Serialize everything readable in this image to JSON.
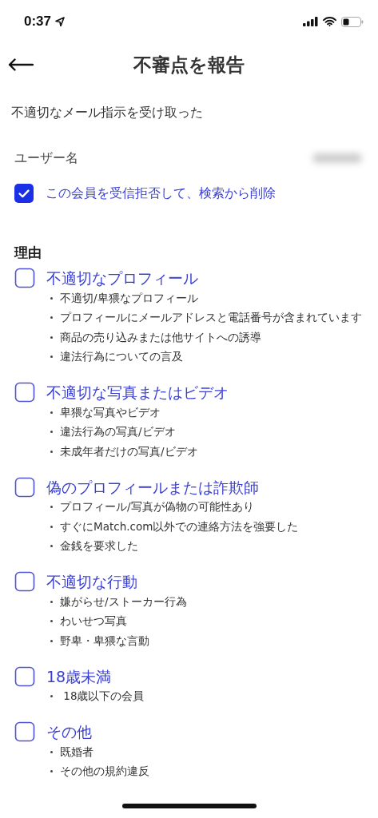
{
  "status_bar": {
    "time": "0:37"
  },
  "header": {
    "title": "不審点を報告"
  },
  "subtitle": "不適切なメール指示を受け取った",
  "username_label": "ユーザー名",
  "block_option": {
    "label": "この会員を受信拒否して、検索から削除",
    "checked": true
  },
  "reasons_heading": "理由",
  "reasons": [
    {
      "title": "不適切なプロフィール",
      "checked": false,
      "items": [
        "不適切/卑猥なプロフィール",
        "プロフィールにメールアドレスと電話番号が含まれています",
        "商品の売り込みまたは他サイトへの誘導",
        "違法行為についての言及"
      ]
    },
    {
      "title": "不適切な写真またはビデオ",
      "checked": false,
      "items": [
        "卑猥な写真やビデオ",
        "違法行為の写真/ビデオ",
        "未成年者だけの写真/ビデオ"
      ]
    },
    {
      "title": "偽のプロフィールまたは詐欺師",
      "checked": false,
      "items": [
        "プロフィール/写真が偽物の可能性あり",
        "すぐにMatch.com以外での連絡方法を強要した",
        "金銭を要求した"
      ]
    },
    {
      "title": "不適切な行動",
      "checked": false,
      "items": [
        "嫌がらせ/ストーカー行為",
        "わいせつ写真",
        "野卑・卑猥な言動"
      ]
    },
    {
      "title": "18歳未満",
      "checked": false,
      "items": [
        " 18歳以下の会員"
      ]
    },
    {
      "title": "その他",
      "checked": false,
      "items": [
        "既婚者",
        "その他の規約違反"
      ]
    }
  ]
}
